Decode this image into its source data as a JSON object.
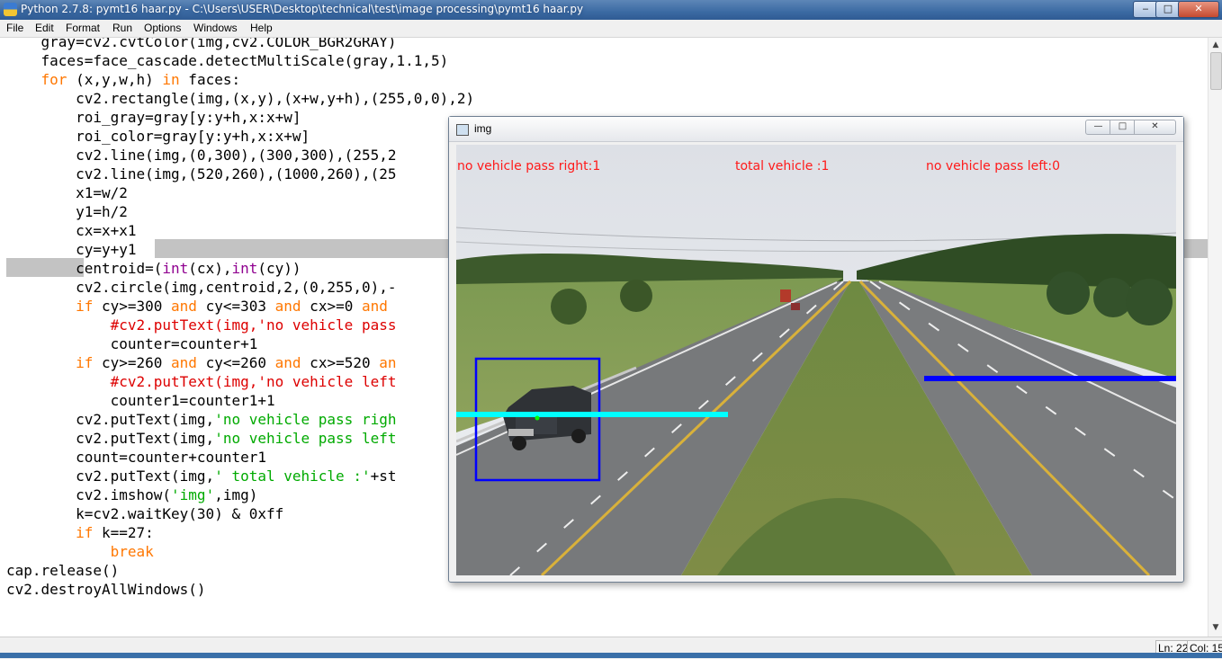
{
  "window": {
    "title": "Python 2.7.8: pymt16 haar.py - C:\\Users\\USER\\Desktop\\technical\\test\\image processing\\pymt16 haar.py",
    "minimize_glyph": "‒",
    "maximize_glyph": "□",
    "close_glyph": "✕"
  },
  "menu": [
    "File",
    "Edit",
    "Format",
    "Run",
    "Options",
    "Windows",
    "Help"
  ],
  "code": [
    [
      [
        "",
        "    gray=cv2.cvtColor(img,cv2.COLOR_BGR2GRAY)"
      ]
    ],
    [
      [
        "",
        "    faces=face_cascade.detectMultiScale(gray,1.1,5)"
      ]
    ],
    [
      [
        "",
        "    "
      ],
      [
        "kw",
        "for"
      ],
      [
        "",
        " (x,y,w,h) "
      ],
      [
        "kw",
        "in"
      ],
      [
        "",
        " faces:"
      ]
    ],
    [
      [
        "",
        "        cv2.rectangle(img,(x,y),(x+w,y+h),(255,0,0),2)"
      ]
    ],
    [
      [
        "",
        "        roi_gray=gray[y:y+h,x:x+w]"
      ]
    ],
    [
      [
        "",
        "        roi_color=gray[y:y+h,x:x+w]"
      ]
    ],
    [
      [
        "",
        "        cv2.line(img,(0,300),(300,300),(255,2"
      ]
    ],
    [
      [
        "",
        "        cv2.line(img,(520,260),(1000,260),(25"
      ]
    ],
    [
      [
        "",
        "        x1=w/2"
      ]
    ],
    [
      [
        "",
        "        y1=h/2"
      ]
    ],
    [
      [
        "",
        "        cx=x+x1"
      ]
    ],
    [
      [
        "",
        "        cy=y+y1"
      ]
    ],
    [
      [
        "",
        "        centroid=("
      ],
      [
        "bi",
        "int"
      ],
      [
        "",
        "(cx),"
      ],
      [
        "bi",
        "int"
      ],
      [
        "",
        "(cy))"
      ]
    ],
    [
      [
        "",
        "        cv2.circle(img,centroid,2,(0,255,0),-"
      ]
    ],
    [
      [
        "",
        "        "
      ],
      [
        "kw",
        "if"
      ],
      [
        "",
        " cy>=300 "
      ],
      [
        "kw",
        "and"
      ],
      [
        "",
        " cy<=303 "
      ],
      [
        "kw",
        "and"
      ],
      [
        "",
        " cx>=0 "
      ],
      [
        "kw",
        "and"
      ]
    ],
    [
      [
        "",
        "            "
      ],
      [
        "cm",
        "#cv2.putText(img,'no vehicle pass"
      ]
    ],
    [
      [
        "",
        "            counter=counter+1"
      ]
    ],
    [
      [
        "",
        "        "
      ],
      [
        "kw",
        "if"
      ],
      [
        "",
        " cy>=260 "
      ],
      [
        "kw",
        "and"
      ],
      [
        "",
        " cy<=260 "
      ],
      [
        "kw",
        "and"
      ],
      [
        "",
        " cx>=520 "
      ],
      [
        "kw",
        "an"
      ]
    ],
    [
      [
        "",
        "            "
      ],
      [
        "cm",
        "#cv2.putText(img,'no vehicle left"
      ]
    ],
    [
      [
        "",
        "            counter1=counter1+1"
      ]
    ],
    [
      [
        "",
        "        cv2.putText(img,"
      ],
      [
        "st",
        "'no vehicle pass righ"
      ]
    ],
    [
      [
        "",
        "        cv2.putText(img,"
      ],
      [
        "st",
        "'no vehicle pass left"
      ]
    ],
    [
      [
        "",
        "        count=counter+counter1"
      ]
    ],
    [
      [
        "",
        "        cv2.putText(img,"
      ],
      [
        "st",
        "' total vehicle :'"
      ],
      [
        "",
        "+st"
      ]
    ],
    [
      [
        "",
        "        cv2.imshow("
      ],
      [
        "st",
        "'img'"
      ],
      [
        "",
        ",img)"
      ]
    ],
    [
      [
        "",
        "        k=cv2.waitKey(30) & 0xff"
      ]
    ],
    [
      [
        "",
        "        "
      ],
      [
        "kw",
        "if"
      ],
      [
        "",
        " k==27:"
      ]
    ],
    [
      [
        "",
        "            "
      ],
      [
        "kw",
        "break"
      ]
    ],
    [
      [
        "",
        "cap.release()"
      ]
    ],
    [
      [
        "",
        "cv2.destroyAllWindows()"
      ]
    ]
  ],
  "status": {
    "line": "Ln: 22",
    "col": "Col: 15"
  },
  "cv_window": {
    "title": "img",
    "minimize_glyph": "—",
    "maximize_glyph": "□",
    "close_glyph": "✕",
    "overlay": {
      "right": "no vehicle pass right:1",
      "total": "total vehicle :1",
      "left": "no vehicle pass left:0"
    }
  },
  "colors": {
    "keyword": "#ff7700",
    "builtin": "#900090",
    "string": "#00aa00",
    "comment": "#dd0000",
    "detect_box": "#0000ff",
    "line_left": "#00ffff",
    "line_right": "#0000ff",
    "overlay_text": "#ff1a1a",
    "centroid": "#00ff00"
  }
}
